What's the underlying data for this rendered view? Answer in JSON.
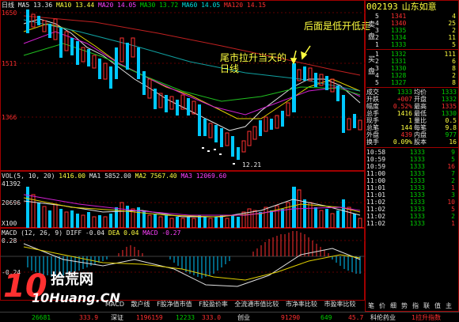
{
  "header": {
    "period": "日线",
    "ma5": "MA5 13.36",
    "ma10": "MA10 13.44",
    "ma20": "MA20 14.05",
    "ma30": "MA30 13.72",
    "ma60": "MA60 14.05",
    "ma120": "MA120 14.15"
  },
  "price_axis": {
    "p1": "1650",
    "p2": "1511",
    "p3": "1366"
  },
  "annotations": {
    "tail_rise_1": "尾市拉升当天的",
    "tail_rise_2": "日线",
    "gap_down": "后面是低开低走",
    "low_mark": "12.21"
  },
  "volume": {
    "header": "VOL(5, 10, 20)",
    "v": "1416.00",
    "ma1": "MA1 5852.00",
    "ma2": "MA2 7567.40",
    "ma3": "MA3 12069.60",
    "axis_top": "41392",
    "axis_mid": "20696",
    "axis_unit": "X100"
  },
  "macd": {
    "header": "MACD (12, 26, 9)",
    "diff": "DIFF -0.04",
    "dea": "DEA 0.04",
    "macd_val": "MACD -0.27",
    "axis_top": "0.28",
    "axis_mid": "-0.24"
  },
  "bottom_tabs": [
    "MACD",
    "散户线",
    "F股净值市值",
    "F股盈价率",
    "全流通市值比较",
    "市净率比较",
    "市盈率比较"
  ],
  "status_bar": {
    "a": "26681",
    "b": "333.9",
    "c": "深证",
    "d": "1196159",
    "e": "12233",
    "f": "333.0",
    "g": "创业",
    "h": "91290",
    "i": "649",
    "j": "45.7",
    "k": "科伦药业",
    "l": "1拉升指数"
  },
  "watermark": {
    "brand": "10",
    "cn": "拾荒网",
    "url": "10Huang.CN"
  },
  "quote": {
    "code": "002193",
    "name": "山东如意",
    "sell_label": "卖盘",
    "buy_label": "买盘",
    "sells": [
      {
        "lvl": "5",
        "price": "1341",
        "vol": "4"
      },
      {
        "lvl": "4",
        "price": "1340",
        "vol": "25"
      },
      {
        "lvl": "3",
        "price": "1335",
        "vol": "2"
      },
      {
        "lvl": "2",
        "price": "1334",
        "vol": "11"
      },
      {
        "lvl": "1",
        "price": "1333",
        "vol": "5"
      }
    ],
    "buys": [
      {
        "lvl": "1",
        "price": "1332",
        "vol": "111"
      },
      {
        "lvl": "2",
        "price": "1331",
        "vol": "6"
      },
      {
        "lvl": "3",
        "price": "1330",
        "vol": "8"
      },
      {
        "lvl": "4",
        "price": "1328",
        "vol": "2"
      },
      {
        "lvl": "5",
        "price": "1327",
        "vol": "8"
      }
    ],
    "stats": [
      {
        "k": "成交",
        "v": "1333",
        "k2": "均价",
        "v2": "1333"
      },
      {
        "k": "升跌",
        "v": "+007",
        "k2": "开盘",
        "v2": "1332"
      },
      {
        "k": "幅度",
        "v": "0.52%",
        "k2": "最高",
        "v2": "1335"
      },
      {
        "k": "总手",
        "v": "1416",
        "k2": "最低",
        "v2": "1330"
      },
      {
        "k": "现手",
        "v": "1",
        "k2": "量比",
        "v2": "0.5"
      },
      {
        "k": "总笔",
        "v": "144",
        "k2": "每笔",
        "v2": "9.8"
      },
      {
        "k": "外盘",
        "v": "439",
        "k2": "内盘",
        "v2": "977"
      },
      {
        "k": "换手",
        "v": "0.09%",
        "k2": "股本",
        "v2": "16"
      }
    ],
    "ticks": [
      {
        "t": "10:58",
        "p": "1333",
        "v": "9"
      },
      {
        "t": "10:59",
        "p": "1333",
        "v": "5"
      },
      {
        "t": "10:59",
        "p": "1333",
        "v": "16"
      },
      {
        "t": "11:00",
        "p": "1333",
        "v": "7"
      },
      {
        "t": "11:00",
        "p": "1333",
        "v": "2"
      },
      {
        "t": "11:01",
        "p": "1333",
        "v": "1"
      },
      {
        "t": "11:01",
        "p": "1333",
        "v": "3"
      },
      {
        "t": "11:02",
        "p": "1333",
        "v": "10"
      },
      {
        "t": "11:02",
        "p": "1333",
        "v": "5"
      },
      {
        "t": "11:02",
        "p": "1333",
        "v": "2"
      },
      {
        "t": "11:02",
        "p": "1333",
        "v": "1"
      }
    ],
    "bottom_tabs": [
      "笔",
      "价",
      "细",
      "势",
      "指",
      "联",
      "值",
      "主"
    ]
  }
}
